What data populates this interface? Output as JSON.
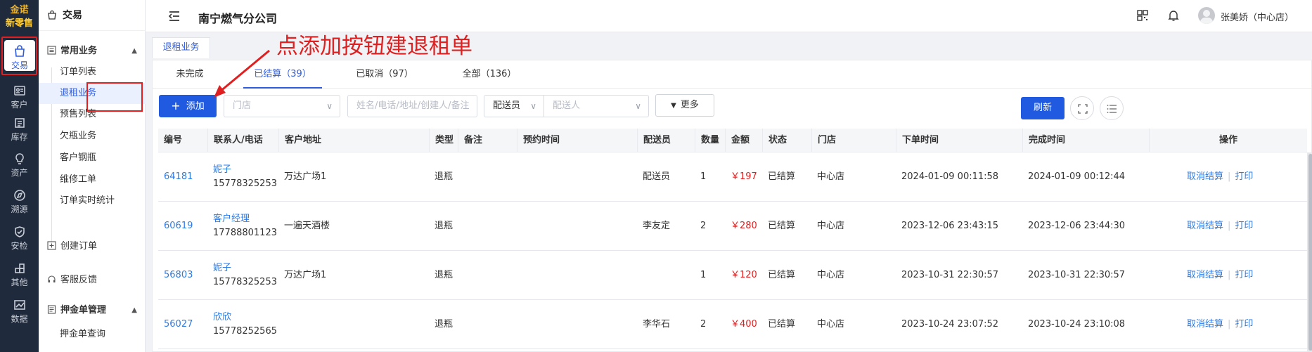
{
  "app": {
    "logo_line1": "金诺",
    "logo_line2": "新零售",
    "company": "南宁燃气分公司",
    "user": "张美娇（中心店）"
  },
  "rail": [
    {
      "label": "交易",
      "icon": "bag-icon"
    },
    {
      "label": "客户",
      "icon": "id-card-icon"
    },
    {
      "label": "库存",
      "icon": "inventory-icon"
    },
    {
      "label": "资产",
      "icon": "bulb-icon"
    },
    {
      "label": "溯源",
      "icon": "compass-icon"
    },
    {
      "label": "安检",
      "icon": "shield-icon"
    },
    {
      "label": "其他",
      "icon": "apps-icon"
    },
    {
      "label": "数据",
      "icon": "chart-icon"
    }
  ],
  "sidebar": {
    "header": "交易",
    "group1": "常用业务",
    "items": [
      "订单列表",
      "退租业务",
      "预售列表",
      "欠瓶业务",
      "客户钢瓶",
      "维修工单",
      "订单实时统计"
    ],
    "create_order": "创建订单",
    "feedback": "客服反馈",
    "group2": "押金单管理",
    "deposit_query": "押金单查询"
  },
  "tag": "退租业务",
  "tabs": [
    "未完成",
    "已结算（39）",
    "已取消（97）",
    "全部（136）"
  ],
  "filters": {
    "add": "添加",
    "store_placeholder": "门店",
    "search_placeholder": "姓名/电话/地址/创建人/备注",
    "dispatcher_select": "配送员",
    "dispatcher_placeholder": "配送人",
    "more": "更多",
    "refresh": "刷新"
  },
  "columns": [
    "编号",
    "联系人/电话",
    "客户地址",
    "类型",
    "备注",
    "预约时间",
    "配送员",
    "数量",
    "金额",
    "状态",
    "门店",
    "下单时间",
    "完成时间",
    "操作"
  ],
  "rows": [
    {
      "id": "64181",
      "name": "妮子",
      "phone": "15778325253",
      "address": "万达广场1",
      "type": "退瓶",
      "note": "",
      "appt": "",
      "courier": "配送员",
      "qty": "1",
      "amount": "￥197",
      "status": "已结算",
      "store": "中心店",
      "ordered": "2024-01-09 00:11:58",
      "done": "2024-01-09 00:12:44"
    },
    {
      "id": "60619",
      "name": "客户经理",
      "phone": "17788801123",
      "address": "一遍天酒楼",
      "type": "退瓶",
      "note": "",
      "appt": "",
      "courier": "李友定",
      "qty": "2",
      "amount": "￥280",
      "status": "已结算",
      "store": "中心店",
      "ordered": "2023-12-06 23:43:15",
      "done": "2023-12-06 23:44:30"
    },
    {
      "id": "56803",
      "name": "妮子",
      "phone": "15778325253",
      "address": "万达广场1",
      "type": "退瓶",
      "note": "",
      "appt": "",
      "courier": "",
      "qty": "1",
      "amount": "￥120",
      "status": "已结算",
      "store": "中心店",
      "ordered": "2023-10-31 22:30:57",
      "done": "2023-10-31 22:30:57"
    },
    {
      "id": "56027",
      "name": "欣欣",
      "phone": "15778252565",
      "address": "",
      "type": "退瓶",
      "note": "",
      "appt": "",
      "courier": "李华石",
      "qty": "2",
      "amount": "￥400",
      "status": "已结算",
      "store": "中心店",
      "ordered": "2023-10-24 23:07:52",
      "done": "2023-10-24 23:10:08"
    }
  ],
  "row_actions": {
    "cancel": "取消结算",
    "print": "打印"
  },
  "annotation": "点添加按钮建退租单",
  "colors": {
    "accent": "#1f5ae0",
    "annotation": "#e02020",
    "rail": "#1f2a3c"
  }
}
